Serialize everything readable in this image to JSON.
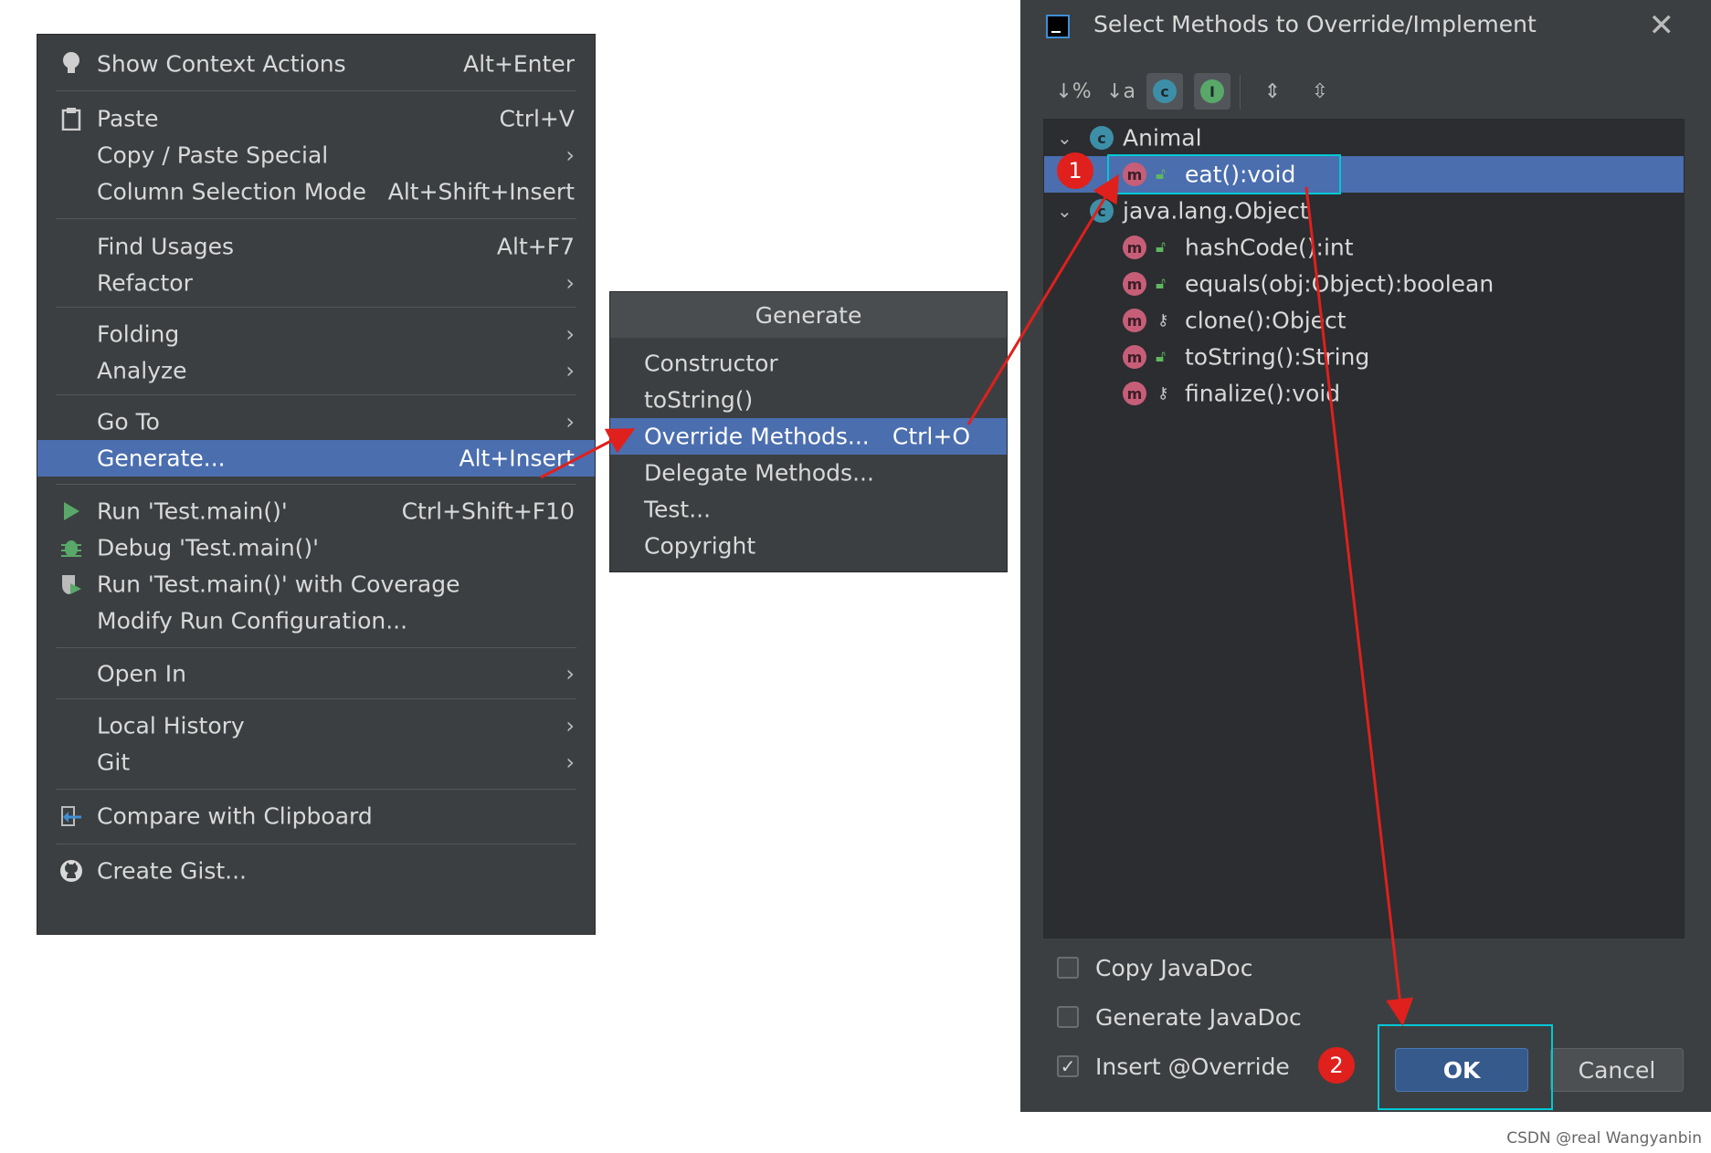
{
  "context_menu": {
    "items": [
      {
        "label": "Show Context Actions",
        "shortcut": "Alt+Enter",
        "icon": "lightbulb-icon"
      },
      {
        "label": "Paste",
        "shortcut": "Ctrl+V",
        "icon": "clipboard-icon"
      },
      {
        "label": "Copy / Paste Special",
        "submenu": true
      },
      {
        "label": "Column Selection Mode",
        "shortcut": "Alt+Shift+Insert"
      },
      {
        "label": "Find Usages",
        "shortcut": "Alt+F7"
      },
      {
        "label": "Refactor",
        "submenu": true
      },
      {
        "label": "Folding",
        "submenu": true
      },
      {
        "label": "Analyze",
        "submenu": true
      },
      {
        "label": "Go To",
        "submenu": true
      },
      {
        "label": "Generate...",
        "shortcut": "Alt+Insert",
        "selected": true
      },
      {
        "label": "Run 'Test.main()'",
        "shortcut": "Ctrl+Shift+F10",
        "icon": "run-icon"
      },
      {
        "label": "Debug 'Test.main()'",
        "icon": "debug-icon"
      },
      {
        "label": "Run 'Test.main()' with Coverage",
        "icon": "coverage-icon"
      },
      {
        "label": "Modify Run Configuration..."
      },
      {
        "label": "Open In",
        "submenu": true
      },
      {
        "label": "Local History",
        "submenu": true
      },
      {
        "label": "Git",
        "submenu": true
      },
      {
        "label": "Compare with Clipboard",
        "icon": "compare-icon"
      },
      {
        "label": "Create Gist...",
        "icon": "github-icon"
      }
    ],
    "submenu_arrow": "›"
  },
  "generate_popup": {
    "title": "Generate",
    "items": [
      {
        "label": "Constructor"
      },
      {
        "label": "toString()"
      },
      {
        "label": "Override Methods...",
        "shortcut": "Ctrl+O",
        "selected": true
      },
      {
        "label": "Delegate Methods..."
      },
      {
        "label": "Test..."
      },
      {
        "label": "Copyright"
      }
    ]
  },
  "dialog": {
    "title": "Select Methods to Override/Implement",
    "close_glyph": "✕",
    "toolbar": [
      {
        "name": "sort-by-visibility-icon",
        "glyph": "↓%"
      },
      {
        "name": "sort-alphabetically-icon",
        "glyph": "↓a"
      },
      {
        "name": "show-classes-icon",
        "glyph": "c"
      },
      {
        "name": "show-interfaces-icon",
        "glyph": "I"
      },
      {
        "name": "expand-all-icon",
        "glyph": "⇕"
      },
      {
        "name": "collapse-all-icon",
        "glyph": "⇳"
      }
    ],
    "tree": [
      {
        "type": "class",
        "label": "Animal",
        "icon_glyph": "c"
      },
      {
        "type": "method",
        "label": "eat():void",
        "icon_glyph": "m",
        "visibility": "public",
        "selected": true
      },
      {
        "type": "class",
        "label": "java.lang.Object",
        "icon_glyph": "c"
      },
      {
        "type": "method",
        "label": "hashCode():int",
        "icon_glyph": "m",
        "visibility": "public"
      },
      {
        "type": "method",
        "label": "equals(obj:Object):boolean",
        "icon_glyph": "m",
        "visibility": "public"
      },
      {
        "type": "method",
        "label": "clone():Object",
        "icon_glyph": "m",
        "visibility": "protected"
      },
      {
        "type": "method",
        "label": "toString():String",
        "icon_glyph": "m",
        "visibility": "public"
      },
      {
        "type": "method",
        "label": "finalize():void",
        "icon_glyph": "m",
        "visibility": "protected"
      }
    ],
    "options": [
      {
        "label": "Copy JavaDoc",
        "checked": false
      },
      {
        "label": "Generate JavaDoc",
        "checked": false
      },
      {
        "label": "Insert @Override",
        "checked": true
      }
    ],
    "ok_label": "OK",
    "cancel_label": "Cancel"
  },
  "annotations": {
    "badge_1": "1",
    "badge_2": "2",
    "highlight_color": "#00c8d6",
    "arrow_color": "#e0201c"
  },
  "watermark": "CSDN @real Wangyanbin",
  "colors": {
    "menu_bg": "#3c3f41",
    "selection": "#4b6eaf",
    "text": "#d9d9d9"
  }
}
